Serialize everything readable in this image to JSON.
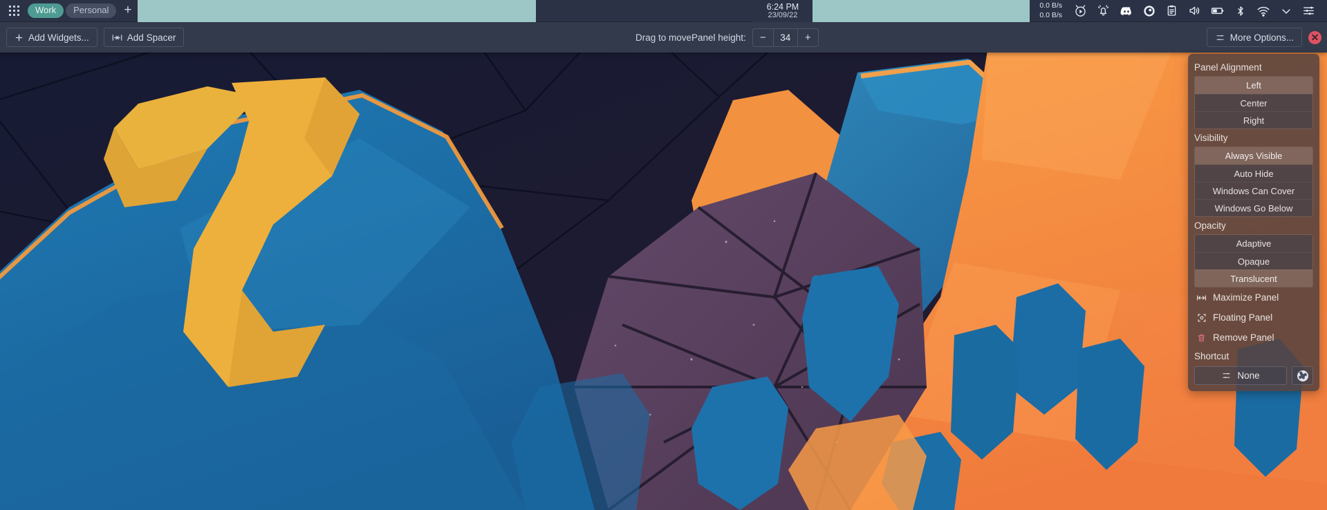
{
  "system_panel": {
    "app_grid_icon": "grid-dots-icon",
    "virtual_desktops": [
      {
        "label": "Work",
        "active": true
      },
      {
        "label": "Personal",
        "active": false
      }
    ],
    "add_desktop_label": "+",
    "clock": {
      "time": "6:24 PM",
      "date": "23/09/22"
    },
    "network_speed": {
      "down": "0.0 B/s",
      "up": "0.0 B/s"
    },
    "tray_icons": [
      "media-player-icon",
      "notifications-bell-icon",
      "discord-icon",
      "volume-orb-icon",
      "clipboard-icon",
      "speaker-icon",
      "battery-icon",
      "bluetooth-icon",
      "wifi-icon",
      "chevron-down-icon",
      "settings-sliders-icon"
    ]
  },
  "edit_toolbar": {
    "add_widgets_label": "Add Widgets...",
    "add_spacer_label": "Add Spacer",
    "drag_hint": "Drag to move",
    "panel_height_label": "Panel height:",
    "panel_height_value": "34",
    "decrement_label": "−",
    "increment_label": "+",
    "more_options_label": "More Options...",
    "close_label": "×"
  },
  "options_popup": {
    "alignment": {
      "title": "Panel Alignment",
      "items": [
        {
          "label": "Left",
          "selected": true
        },
        {
          "label": "Center",
          "selected": false
        },
        {
          "label": "Right",
          "selected": false
        }
      ]
    },
    "visibility": {
      "title": "Visibility",
      "items": [
        {
          "label": "Always Visible",
          "selected": true
        },
        {
          "label": "Auto Hide",
          "selected": false
        },
        {
          "label": "Windows Can Cover",
          "selected": false
        },
        {
          "label": "Windows Go Below",
          "selected": false
        }
      ]
    },
    "opacity": {
      "title": "Opacity",
      "items": [
        {
          "label": "Adaptive",
          "selected": false
        },
        {
          "label": "Opaque",
          "selected": false
        },
        {
          "label": "Translucent",
          "selected": true
        }
      ]
    },
    "actions": [
      {
        "label": "Maximize Panel",
        "icon": "maximize-horizontal-icon"
      },
      {
        "label": "Floating Panel",
        "icon": "floating-panel-icon"
      },
      {
        "label": "Remove Panel",
        "icon": "trash-icon"
      }
    ],
    "shortcut": {
      "title": "Shortcut",
      "value": "None",
      "icon": "sliders-icon",
      "side_button_icon": "globe-icon"
    }
  },
  "theme": {
    "panel_bg": "#2b3245",
    "toolbar_bg": "#333a4b",
    "task_strip": "#9cc7c6",
    "active_desktop": "#4e9b93",
    "inactive_desktop": "#474f63",
    "popup_bg": "rgba(86,66,63,0.88)",
    "selected_item": "rgba(150,126,118,0.52)",
    "close_red": "#e05263",
    "trash_red": "#e07080",
    "text": "#d7dde9"
  },
  "wallpaper": {
    "name": "low-poly-abstract-wallpaper",
    "palette": {
      "deep_navy": "#151a33",
      "dark_plum": "#2a1e33",
      "mid_blue": "#1f6fa8",
      "steel_blue": "#2a7fb5",
      "deep_blue": "#16507f",
      "orange": "#f59440",
      "amber": "#edae3b",
      "gold": "#e8b33c",
      "purple_grey": "#5a4659"
    }
  }
}
